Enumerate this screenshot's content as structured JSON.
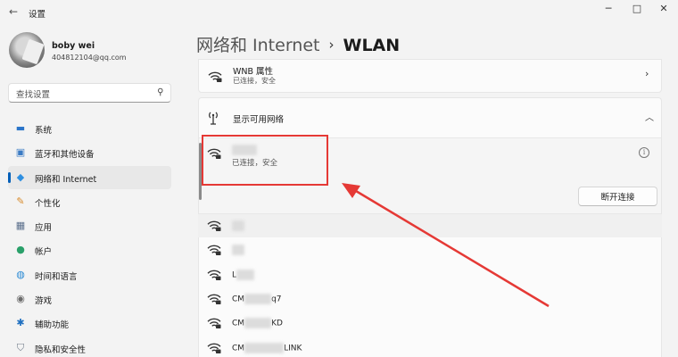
{
  "window": {
    "title": "设置",
    "back_glyph": "←",
    "minimize_glyph": "─",
    "maximize_glyph": "□",
    "close_glyph": "✕"
  },
  "user": {
    "name": "boby wei",
    "email": "404812104@qq.com"
  },
  "search": {
    "placeholder": "查找设置"
  },
  "sidebar": {
    "items": [
      {
        "label": "系统",
        "icon": "monitor-icon",
        "glyph": "▬",
        "color": "#2a74c9"
      },
      {
        "label": "蓝牙和其他设备",
        "icon": "devices-icon",
        "glyph": "▣",
        "color": "#3b7bc4"
      },
      {
        "label": "网络和 Internet",
        "icon": "wifi-network-icon",
        "glyph": "◆",
        "color": "#2f8fe0"
      },
      {
        "label": "个性化",
        "icon": "pen-icon",
        "glyph": "✎",
        "color": "#d88a2a"
      },
      {
        "label": "应用",
        "icon": "apps-icon",
        "glyph": "▦",
        "color": "#5b6f8c"
      },
      {
        "label": "帐户",
        "icon": "account-icon",
        "glyph": "●",
        "color": "#2aa06a"
      },
      {
        "label": "时间和语言",
        "icon": "clock-globe-icon",
        "glyph": "◍",
        "color": "#2a8ad4"
      },
      {
        "label": "游戏",
        "icon": "gamepad-icon",
        "glyph": "◉",
        "color": "#6b6b6b"
      },
      {
        "label": "辅助功能",
        "icon": "accessibility-icon",
        "glyph": "✱",
        "color": "#1f6fc0"
      },
      {
        "label": "隐私和安全性",
        "icon": "shield-icon",
        "glyph": "⛉",
        "color": "#6f7a88"
      }
    ],
    "active_index": 2,
    "accent": "#005fb8"
  },
  "breadcrumb": {
    "parent": "网络和 Internet",
    "separator": "›",
    "current": "WLAN"
  },
  "connected_props": {
    "title": "WNB 属性",
    "subtitle": "已连接，安全"
  },
  "networks_section": {
    "title": "显示可用网络"
  },
  "current_network": {
    "status": "已连接，安全",
    "disconnect_label": "断开连接",
    "info_glyph": "i"
  },
  "available_networks": [
    {
      "prefix": ""
    },
    {
      "prefix": ""
    },
    {
      "prefix": "L"
    },
    {
      "prefix": "CM",
      "suffix": "q7"
    },
    {
      "prefix": "CM",
      "suffix": "KD"
    },
    {
      "prefix": "CM",
      "suffix": "LINK"
    }
  ],
  "annotation": {
    "color": "#e53935"
  }
}
